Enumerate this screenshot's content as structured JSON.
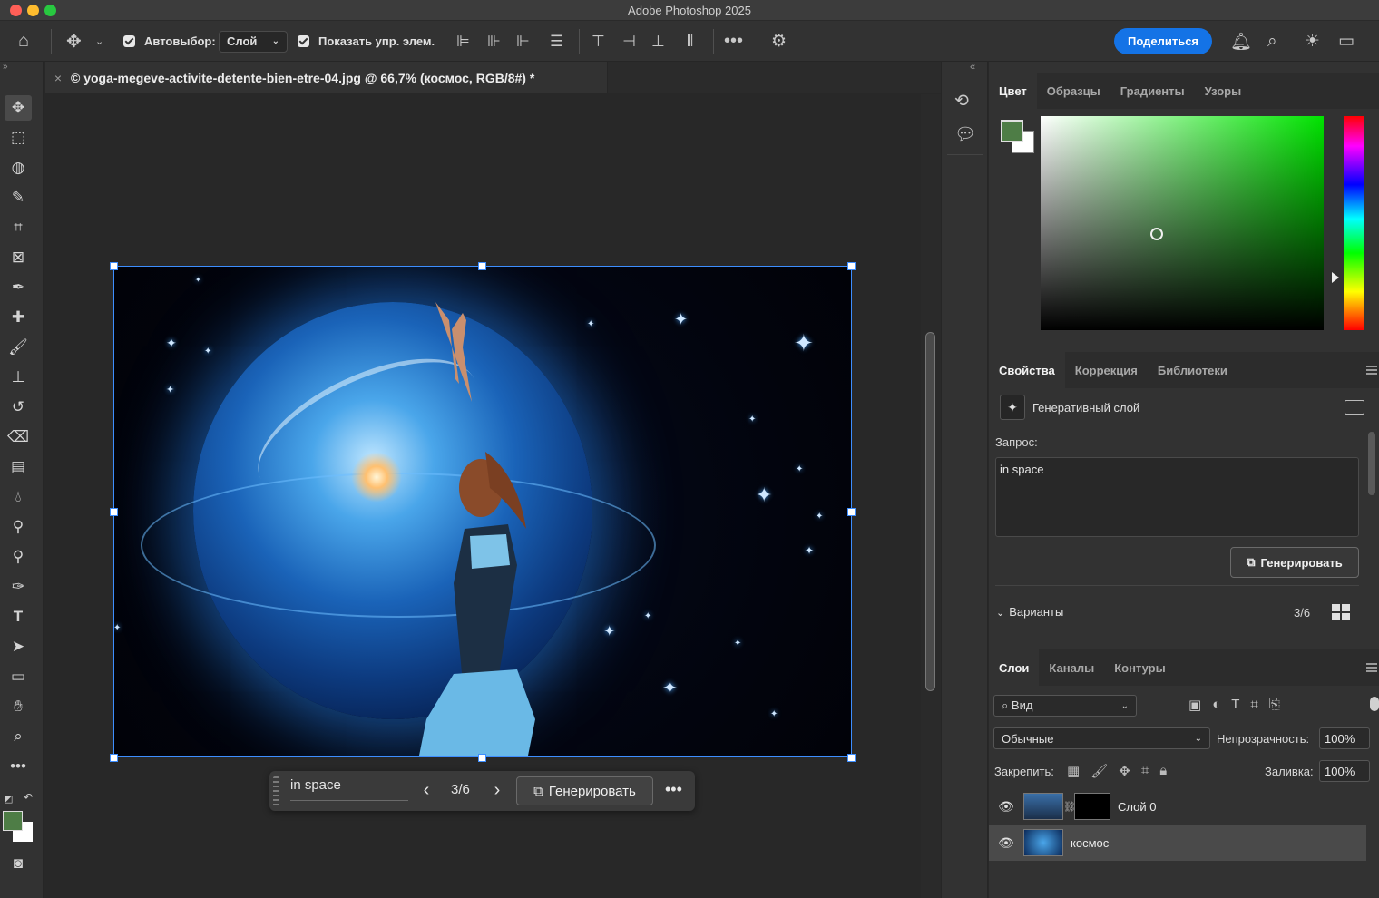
{
  "window": {
    "title": "Adobe Photoshop 2025"
  },
  "optionsbar": {
    "autoselect_label": "Автовыбор:",
    "autoselect_value": "Слой",
    "show_transform_label": "Показать упр. элем.",
    "share_label": "Поделиться"
  },
  "document": {
    "tab_title": "© yoga-megeve-activite-detente-bien-etre-04.jpg @ 66,7% (космос, RGB/8#) *"
  },
  "taskbar": {
    "prompt": "in space",
    "counter": "3/6",
    "generate_label": "Генерировать"
  },
  "color_panel": {
    "tabs": [
      "Цвет",
      "Образцы",
      "Градиенты",
      "Узоры"
    ],
    "foreground": "#4e7d46",
    "background": "#ffffff"
  },
  "properties_panel": {
    "tabs": [
      "Свойства",
      "Коррекция",
      "Библиотеки"
    ],
    "layer_type": "Генеративный слой",
    "prompt_label": "Запрос:",
    "prompt_value": "in space",
    "generate_label": "Генерировать",
    "variants_label": "Варианты",
    "variants_count": "3/6"
  },
  "layers_panel": {
    "tabs": [
      "Слои",
      "Каналы",
      "Контуры"
    ],
    "filter_value": "Вид",
    "blend_mode": "Обычные",
    "opacity_label": "Непрозрачность:",
    "opacity_value": "100%",
    "lock_label": "Закрепить:",
    "fill_label": "Заливка:",
    "fill_value": "100%",
    "layers": [
      {
        "name": "Слой 0"
      },
      {
        "name": "космос"
      }
    ]
  }
}
